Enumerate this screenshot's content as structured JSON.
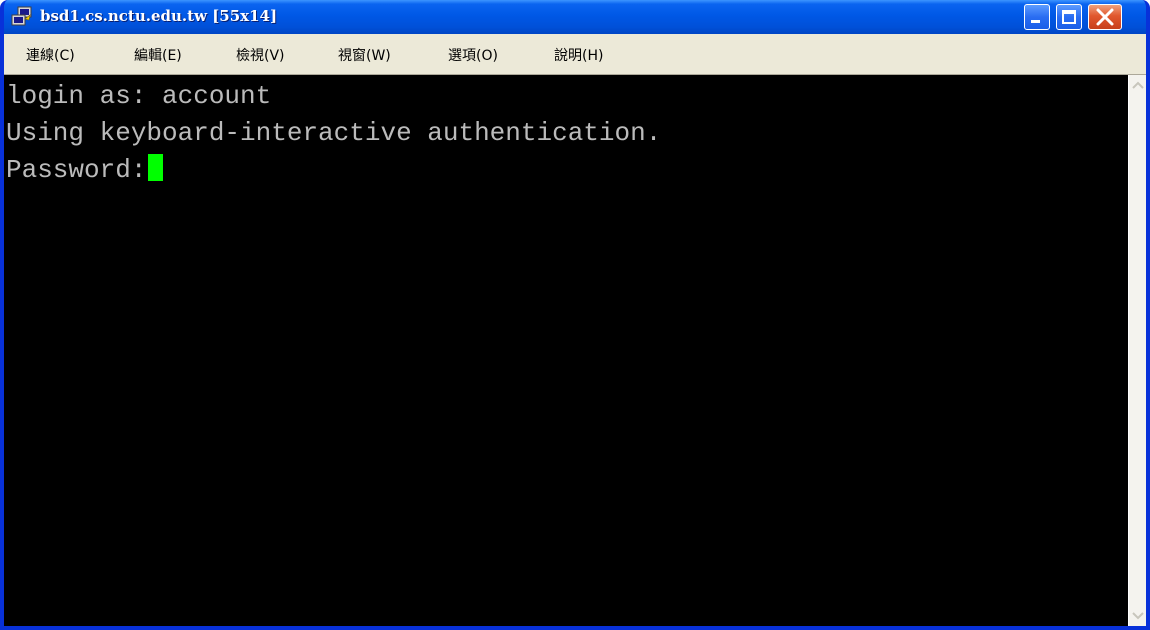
{
  "window": {
    "title": "bsd1.cs.nctu.edu.tw [55x14]",
    "icon": "putty-icon"
  },
  "menu": {
    "items": [
      {
        "label": "連線(C)"
      },
      {
        "label": "編輯(E)"
      },
      {
        "label": "檢視(V)"
      },
      {
        "label": "視窗(W)"
      },
      {
        "label": "選項(O)"
      },
      {
        "label": "說明(H)"
      }
    ]
  },
  "terminal": {
    "lines": [
      "login as: account",
      "Using keyboard-interactive authentication.",
      "Password:"
    ],
    "text_color": "#bbbbbb",
    "background": "#000000",
    "cursor_color": "#00ff00"
  }
}
